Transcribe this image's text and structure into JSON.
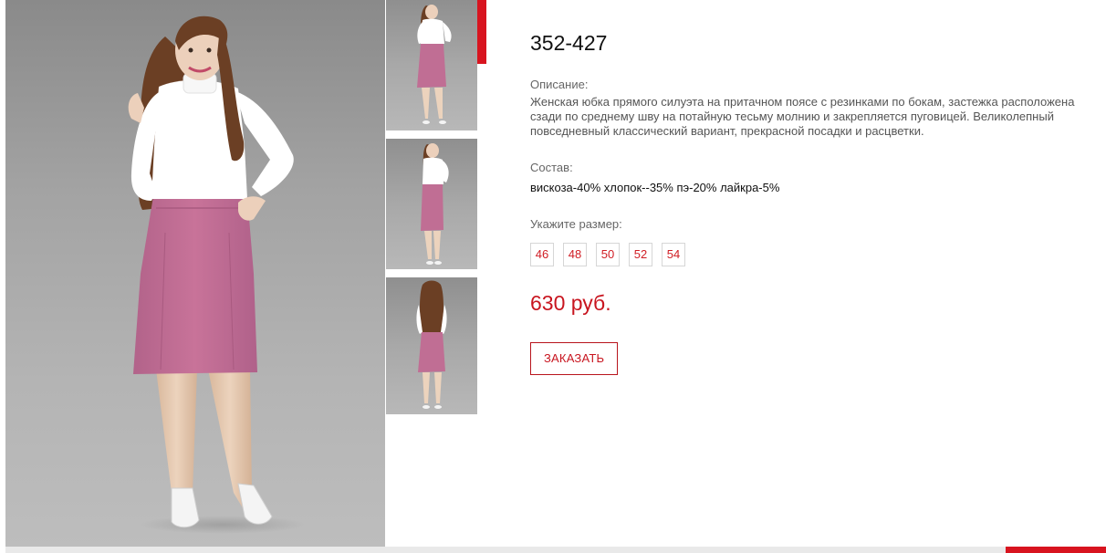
{
  "product": {
    "sku": "352-427",
    "description_label": "Описание:",
    "description": "Женская юбка прямого силуэта на притачном поясе с резинками по бокам, застежка расположена сзади по среднему шву на потайную тесьму молнию и закрепляется пуговицей. Великолепный повседневный классический  вариант, прекрасной посадки и расцветки.",
    "composition_label": "Состав:",
    "composition": "вискоза-40% хлопок--35% пэ-20% лайкра-5%",
    "size_label": "Укажите размер:",
    "sizes": [
      "46",
      "48",
      "50",
      "52",
      "54"
    ],
    "price": "630 руб.",
    "order_label": "ЗАКАЗАТЬ"
  },
  "colors": {
    "accent": "#d8141f",
    "skirt": "#c06e94",
    "top": "#ffffff",
    "background": "#a4a4a4"
  },
  "gallery": {
    "main_view": "front",
    "thumbnails": [
      "front",
      "side",
      "back"
    ],
    "active_thumbnail": 0
  }
}
